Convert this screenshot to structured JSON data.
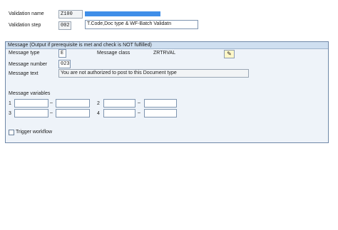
{
  "header": {
    "validation_name_label": "Validation name",
    "validation_name_value": "Z100",
    "validation_step_label": "Validation step",
    "validation_step_value": "002",
    "validation_step_description": "T.Code,Doc type & WF-Batch Validatn"
  },
  "message_group": {
    "title": "Message (Output if prerequisite is met and check is NOT fulfilled)",
    "message_type_label": "Message type",
    "message_type_value": "E",
    "message_class_label": "Message class",
    "message_class_value": "ZRTRVAL",
    "message_number_label": "Message number",
    "message_number_value": "023",
    "message_text_label": "Message text",
    "message_text_value": "You are not authorized to post to this Document type",
    "edit_icon": "pencil-icon",
    "message_variables_label": "Message variables",
    "variables": [
      {
        "index": "1",
        "from": "",
        "to": ""
      },
      {
        "index": "2",
        "from": "",
        "to": ""
      },
      {
        "index": "3",
        "from": "",
        "to": ""
      },
      {
        "index": "4",
        "from": "",
        "to": ""
      }
    ],
    "range_separator": "–",
    "trigger_workflow_label": "Trigger workflow",
    "trigger_workflow_checked": false
  },
  "colors": {
    "group_background": "#eef3f9",
    "group_title_background": "#cfdff0",
    "selection_highlight": "#3f8ee8"
  }
}
